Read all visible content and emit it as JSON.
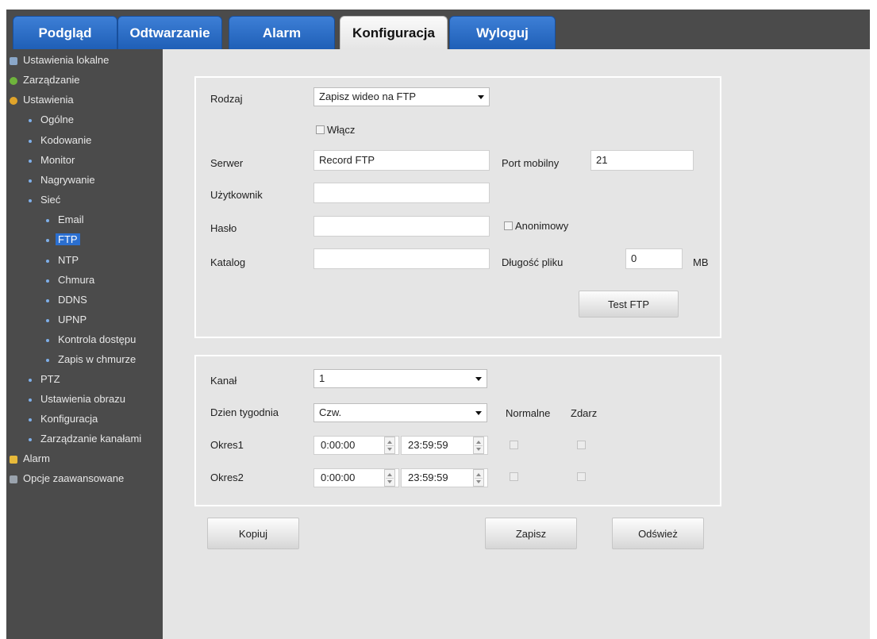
{
  "nav": {
    "tabs": [
      "Podgląd",
      "Odtwarzanie",
      "Alarm",
      "Konfiguracja",
      "Wyloguj"
    ],
    "active_tab": "Konfiguracja"
  },
  "sidebar": {
    "local_settings": "Ustawienia lokalne",
    "management": "Zarządzanie",
    "settings": "Ustawienia",
    "general": "Ogólne",
    "encoding": "Kodowanie",
    "monitor": "Monitor",
    "recording": "Nagrywanie",
    "network": "Sieć",
    "email": "Email",
    "ftp": "FTP",
    "ntp": "NTP",
    "cloud": "Chmura",
    "ddns": "DDNS",
    "upnp": "UPNP",
    "access_control": "Kontrola dostępu",
    "cloud_record": "Zapis w chmurze",
    "ptz": "PTZ",
    "image_settings": "Ustawienia obrazu",
    "configuration": "Konfiguracja",
    "channel_management": "Zarządzanie kanałami",
    "alarm": "Alarm",
    "advanced": "Opcje zaawansowane"
  },
  "ftp": {
    "type_label": "Rodzaj",
    "type_value": "Zapisz wideo na FTP",
    "enable_label": "Włącz",
    "server_label": "Serwer",
    "server_value": "Record FTP",
    "port_label": "Port mobilny",
    "port_value": "21",
    "user_label": "Użytkownik",
    "user_value": "",
    "password_label": "Hasło",
    "password_value": "",
    "anonymous_label": "Anonimowy",
    "directory_label": "Katalog",
    "directory_value": "",
    "file_length_label": "Długość pliku",
    "file_length_value": "0",
    "file_length_unit": "MB",
    "test_button": "Test FTP"
  },
  "schedule": {
    "channel_label": "Kanał",
    "channel_value": "1",
    "weekday_label": "Dzien tygodnia",
    "weekday_value": "Czw.",
    "col_normal": "Normalne",
    "col_event": "Zdarz",
    "period1_label": "Okres1",
    "period1_start": "0:00:00",
    "period1_end": "23:59:59",
    "period2_label": "Okres2",
    "period2_start": "0:00:00",
    "period2_end": "23:59:59"
  },
  "actions": {
    "copy": "Kopiuj",
    "save": "Zapisz",
    "refresh": "Odśwież"
  }
}
